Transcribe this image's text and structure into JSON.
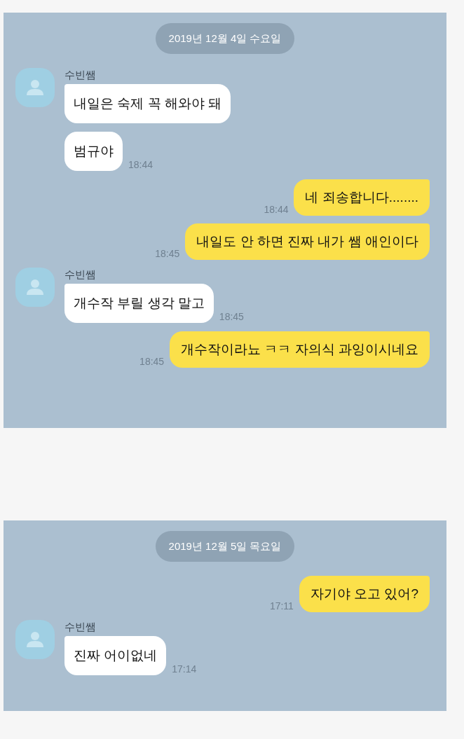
{
  "panels": [
    {
      "date": "2019년 12월 4일 수요일",
      "messages": [
        {
          "kind": "received",
          "sender": "수빈쌤",
          "bubbles": [
            {
              "text": "내일은 숙제 꼭 해와야 돼"
            },
            {
              "text": "범규야",
              "time": "18:44"
            }
          ]
        },
        {
          "kind": "sent",
          "text": "네 죄송합니다........",
          "time": "18:44"
        },
        {
          "kind": "sent",
          "text": "내일도 안 하면 진짜 내가 쌤 애인이다",
          "time": "18:45"
        },
        {
          "kind": "received",
          "sender": "수빈쌤",
          "bubbles": [
            {
              "text": "개수작 부릴 생각 말고",
              "time": "18:45"
            }
          ]
        },
        {
          "kind": "sent",
          "text": "개수작이라뇨 ㅋㅋ 자의식 과잉이시네요",
          "time": "18:45"
        }
      ]
    },
    {
      "date": "2019년 12월 5일 목요일",
      "messages": [
        {
          "kind": "sent",
          "text": "자기야 오고 있어?",
          "time": "17:11"
        },
        {
          "kind": "received",
          "sender": "수빈쌤",
          "bubbles": [
            {
              "text": "진짜 어이없네",
              "time": "17:14"
            }
          ]
        }
      ]
    }
  ]
}
